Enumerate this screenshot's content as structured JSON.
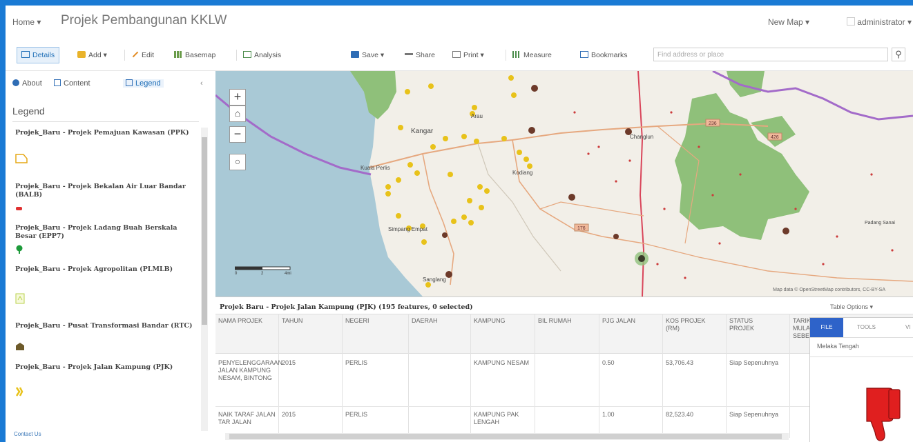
{
  "header": {
    "home_label": "Home ▾",
    "title": "Projek Pembangunan KKLW",
    "new_map_label": "New Map ▾",
    "user_label": "administrator ▾"
  },
  "toolbar": {
    "details": "Details",
    "add": "Add ▾",
    "edit": "Edit",
    "basemap": "Basemap",
    "analysis": "Analysis",
    "save": "Save ▾",
    "share": "Share",
    "print": "Print ▾",
    "measure": "Measure",
    "bookmarks": "Bookmarks",
    "search_placeholder": "Find address or place"
  },
  "panel": {
    "tabs": [
      "About",
      "Content",
      "Legend"
    ],
    "heading": "Legend",
    "contact": "Contact Us",
    "legend_items": [
      {
        "label": "Projek_Baru - Projek Pemajuan Kawasan (PPK)",
        "icon": "polygon-outline-icon",
        "color": "#e6a817"
      },
      {
        "label": "Projek_Baru - Projek Bekalan Air Luar Bandar (BALB)",
        "icon": "red-marker-icon",
        "color": "#e03030"
      },
      {
        "label": "Projek_Baru - Projek Ladang Buah Berskala Besar (EPP7)",
        "icon": "tree-icon",
        "color": "#1d9a3a"
      },
      {
        "label": "Projek_Baru - Projek Agropolitan (PLMLB)",
        "icon": "agro-icon",
        "color": "#b9d24b"
      },
      {
        "label": "Projek_Baru - Pusat Transformasi Bandar (RTC)",
        "icon": "building-icon",
        "color": "#6d5a2a"
      },
      {
        "label": "Projek_Baru - Projek Jalan Kampung (PJK)",
        "icon": "road-icon",
        "color": "#e8c21a"
      }
    ]
  },
  "map": {
    "labels": [
      "Kangar",
      "Kuala Perlis",
      "Arau",
      "Kodiang",
      "Simpang Empat",
      "Sanglang",
      "Changlun",
      "Padang Sanai"
    ],
    "road_shields": [
      "236",
      "426",
      "176"
    ],
    "scale": [
      "0",
      "2",
      "4mi"
    ],
    "attribution": "Map data © OpenStreetMap contributors, CC-BY-SA"
  },
  "table": {
    "caption": "Projek Baru - Projek Jalan Kampung (PJK) (195 features, 0 selected)",
    "options_label": "Table Options ▾",
    "columns": [
      "NAMA PROJEK",
      "TAHUN",
      "NEGERI",
      "DAERAH",
      "KAMPUNG",
      "BIL RUMAH",
      "PJG JALAN",
      "KOS PROJEK (RM)",
      "STATUS PROJEK",
      "TARIKH MULA SEBENAR"
    ],
    "rows": [
      [
        "PENYELENGGARAAN JALAN KAMPUNG NESAM, BINTONG",
        "2015",
        "PERLIS",
        "",
        "KAMPUNG NESAM",
        "",
        "0.50",
        "53,706.43",
        "Siap Sepenuhnya",
        ""
      ],
      [
        "NAIK TARAF JALAN TAR JALAN",
        "2015",
        "PERLIS",
        "",
        "KAMPUNG PAK LENGAH",
        "",
        "1.00",
        "82,523.40",
        "Siap Sepenuhnya",
        ""
      ]
    ]
  },
  "popup": {
    "tabs": [
      "FILE",
      "TOOLS",
      "VI"
    ],
    "field_value": "Melaka Tengah",
    "icon": "thumbs-down-icon",
    "icon_color": "#e01f1f"
  },
  "colors": {
    "accent": "#1f6fb7",
    "sea": "#a9c9d6",
    "forest": "#8fc07a",
    "border_purple": "#a36bc9",
    "road": "#e6a87f"
  }
}
